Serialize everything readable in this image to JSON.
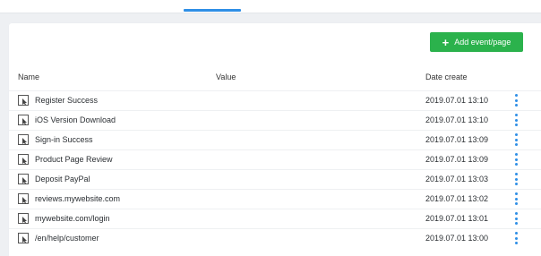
{
  "header": {
    "add_button_label": "Add event/page"
  },
  "table": {
    "columns": [
      "Name",
      "Value",
      "Date create"
    ],
    "rows": [
      {
        "name": "Register Success",
        "date": "2019.07.01 13:10"
      },
      {
        "name": "iOS Version Download",
        "date": "2019.07.01 13:10"
      },
      {
        "name": "Sign-in Success",
        "date": "2019.07.01 13:09"
      },
      {
        "name": "Product Page Review",
        "date": "2019.07.01 13:09"
      },
      {
        "name": "Deposit PayPal",
        "date": "2019.07.01 13:03"
      },
      {
        "name": "reviews.mywebsite.com",
        "date": "2019.07.01 13:02"
      },
      {
        "name": "mywebsite.com/login",
        "date": "2019.07.01 13:01"
      },
      {
        "name": "/en/help/customer",
        "date": "2019.07.01 13:00"
      }
    ]
  },
  "icons": {
    "row_icon": "cursor-square-icon",
    "row_menu": "kebab-menu-icon",
    "add": "plus-icon"
  },
  "colors": {
    "accent": "#2f8fe6",
    "add_button": "#2bb24c"
  }
}
